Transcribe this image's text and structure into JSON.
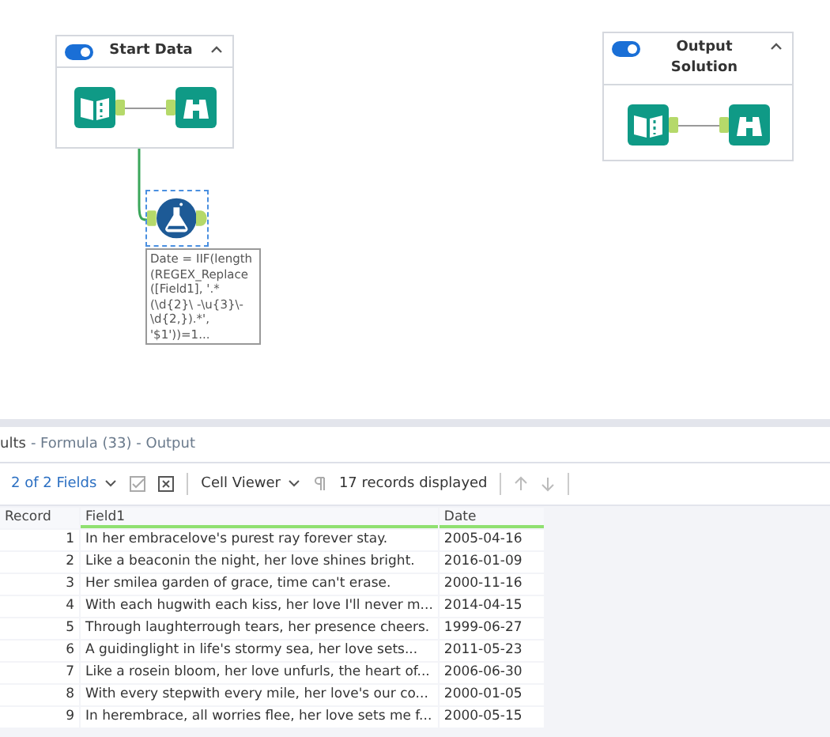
{
  "canvas": {
    "containers": [
      {
        "title": "Start Data",
        "toggle_on": true,
        "expanded": true
      },
      {
        "title": "Output Solution",
        "toggle_on": true,
        "expanded": true
      }
    ],
    "formula_tool": {
      "selected": true,
      "annotation": "Date = IIF(length (REGEX_Replace ([Field1], '.*(\\d{2}\\ -\\u{3}\\-\\d{2,}).*', '$1'))=1..."
    }
  },
  "results": {
    "title_prefix": "ults",
    "title_path": "- Formula (33) - Output",
    "fields_menu": "2 of 2 Fields",
    "viewer_menu": "Cell Viewer",
    "record_count": "17 records displayed",
    "columns": [
      "Record",
      "Field1",
      "Date"
    ],
    "rows": [
      [
        "1",
        "In her embracelove's purest ray forever stay.",
        "2005-04-16"
      ],
      [
        "2",
        "Like a beaconin the night, her love shines bright.",
        "2016-01-09"
      ],
      [
        "3",
        "Her smilea garden of grace, time can't erase.",
        "2000-11-16"
      ],
      [
        "4",
        "With each hugwith each kiss, her love I'll never m...",
        "2014-04-15"
      ],
      [
        "5",
        "Through laughterrough tears, her presence cheers.",
        "1999-06-27"
      ],
      [
        "6",
        "A guidinglight in life's stormy sea, her love sets...",
        "2011-05-23"
      ],
      [
        "7",
        "Like a rosein bloom, her love unfurls, the heart of...",
        "2006-06-30"
      ],
      [
        "8",
        "With every stepwith every mile, her love's our co...",
        "2000-01-05"
      ],
      [
        "9",
        "In herembrace, all worries flee, her love sets me f...",
        "2000-05-15"
      ]
    ]
  }
}
